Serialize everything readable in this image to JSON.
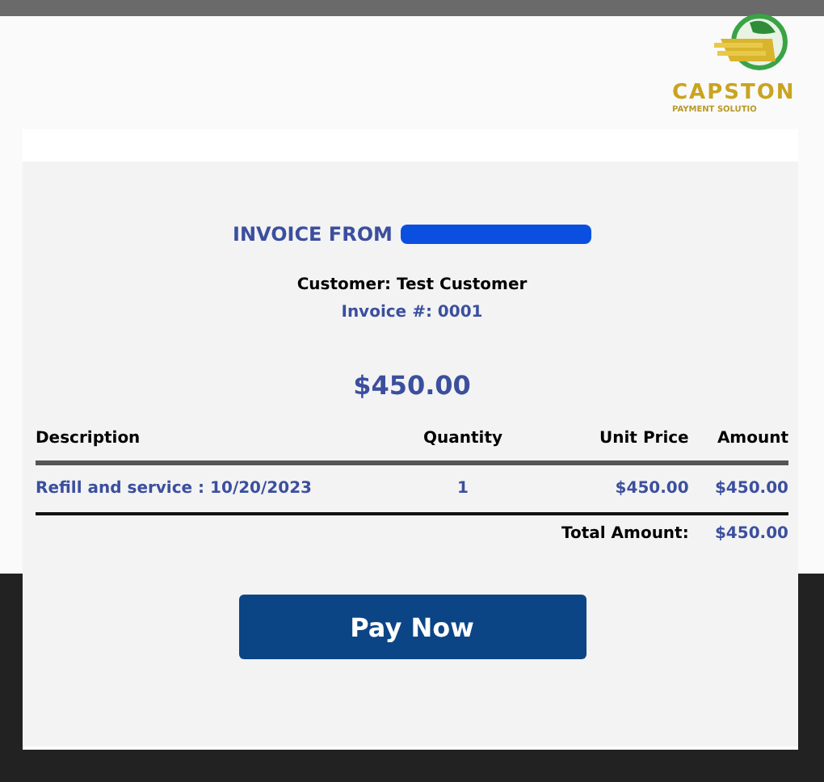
{
  "logo": {
    "name": "CAPSTON",
    "tagline": "PAYMENT SOLUTIO"
  },
  "invoice": {
    "heading": "INVOICE FROM",
    "customer": "Customer: Test Customer",
    "number": "Invoice #: 0001",
    "amount": "$450.00"
  },
  "table": {
    "columns": [
      "Description",
      "Quantity",
      "Unit Price",
      "Amount"
    ],
    "rows": [
      [
        "Refill and service : 10/20/2023",
        "1",
        "$450.00",
        "$450.00"
      ]
    ],
    "total_label": "Total Amount:",
    "total": "$450.00"
  },
  "buttons": [
    "Pay Now"
  ]
}
